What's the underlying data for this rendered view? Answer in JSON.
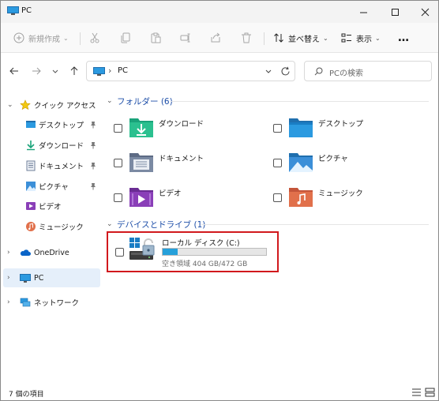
{
  "window": {
    "title": "PC",
    "controls": [
      "minimize",
      "maximize",
      "close"
    ]
  },
  "toolbar": {
    "new_label": "新規作成",
    "sort_label": "並べ替え",
    "view_label": "表示",
    "more_label": "…"
  },
  "address": {
    "crumb": "PC",
    "search_placeholder": "PCの検索"
  },
  "sidebar": {
    "quick_access": "クイック アクセス",
    "items": [
      {
        "label": "デスクトップ",
        "icon": "desktop-folder-icon",
        "pinned": true
      },
      {
        "label": "ダウンロード",
        "icon": "downloads-folder-icon",
        "pinned": true
      },
      {
        "label": "ドキュメント",
        "icon": "documents-folder-icon",
        "pinned": true
      },
      {
        "label": "ピクチャ",
        "icon": "pictures-folder-icon",
        "pinned": true
      },
      {
        "label": "ビデオ",
        "icon": "videos-folder-icon",
        "pinned": false
      },
      {
        "label": "ミュージック",
        "icon": "music-folder-icon",
        "pinned": false
      }
    ],
    "onedrive": "OneDrive",
    "pc": "PC",
    "network": "ネットワーク"
  },
  "main": {
    "folders_group": "フォルダー (6)",
    "folders": [
      {
        "name": "ダウンロード",
        "icon": "downloads-folder-icon"
      },
      {
        "name": "デスクトップ",
        "icon": "desktop-folder-icon"
      },
      {
        "name": "ドキュメント",
        "icon": "documents-folder-icon"
      },
      {
        "name": "ピクチャ",
        "icon": "pictures-folder-icon"
      },
      {
        "name": "ビデオ",
        "icon": "videos-folder-icon"
      },
      {
        "name": "ミュージック",
        "icon": "music-folder-icon"
      }
    ],
    "devices_group": "デバイスとドライブ (1)",
    "drive": {
      "name": "ローカル ディスク (C:)",
      "free_text": "空き領域 404 GB/472 GB",
      "used_fraction": 0.144
    }
  },
  "status": {
    "item_count": "7 個の項目"
  },
  "colors": {
    "accent": "#1d4ea8",
    "highlight": "#d1191d",
    "drive_bar": "#26a0da",
    "selected_bg": "#e5effa"
  }
}
